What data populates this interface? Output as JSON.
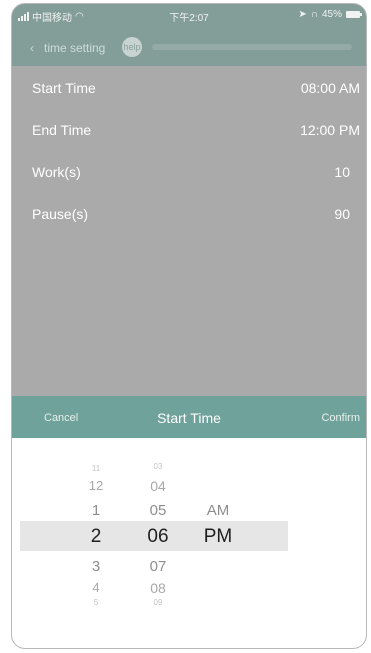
{
  "status_bar": {
    "carrier": "中国移动",
    "time": "下午2:07",
    "battery": "45%"
  },
  "nav": {
    "title": "time setting",
    "help_label": "help"
  },
  "settings": [
    {
      "label": "Start Time",
      "value": "08:00 AM"
    },
    {
      "label": "End Time",
      "value": "12:00 PM"
    },
    {
      "label": "Work(s)",
      "value": "10"
    },
    {
      "label": "Pause(s)",
      "value": "90"
    }
  ],
  "picker_toolbar": {
    "cancel": "Cancel",
    "title": "Start Time",
    "confirm": "Confirm"
  },
  "picker": {
    "hours": [
      "11",
      "12",
      "1",
      "2",
      "3",
      "4",
      "5"
    ],
    "minutes": [
      "03",
      "04",
      "05",
      "06",
      "07",
      "08",
      "09"
    ],
    "ampm": [
      "AM",
      "PM"
    ],
    "selected": {
      "hour": "2",
      "minute": "06",
      "ampm": "PM"
    }
  },
  "colors": {
    "header": "#839e99",
    "toolbar": "#6fa29a",
    "overlay": "#aaaaaa"
  }
}
